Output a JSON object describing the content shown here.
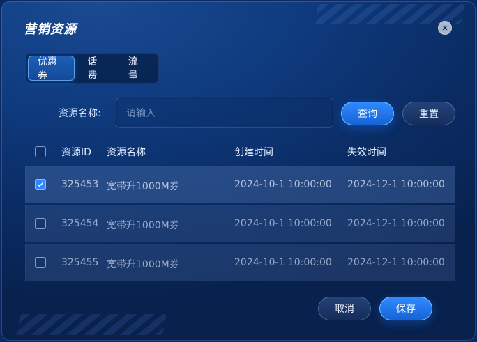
{
  "dialog": {
    "title": "营销资源",
    "close_icon": "close-icon"
  },
  "tabs": [
    {
      "label": "优惠券",
      "active": true
    },
    {
      "label": "话费",
      "active": false
    },
    {
      "label": "流量",
      "active": false
    }
  ],
  "filter": {
    "label": "资源名称:",
    "placeholder": "请输入",
    "query_label": "查询",
    "reset_label": "重置"
  },
  "table": {
    "headers": {
      "resource_id": "资源ID",
      "resource_name": "资源名称",
      "created_time": "创建时间",
      "expire_time": "失效时间"
    },
    "rows": [
      {
        "selected": true,
        "id": "325453",
        "name": "宽带升1000M券",
        "created": "2024-10-1 10:00:00",
        "expire": "2024-12-1 10:00:00"
      },
      {
        "selected": false,
        "id": "325454",
        "name": "宽带升1000M券",
        "created": "2024-10-1 10:00:00",
        "expire": "2024-12-1 10:00:00"
      },
      {
        "selected": false,
        "id": "325455",
        "name": "宽带升1000M券",
        "created": "2024-10-1 10:00:00",
        "expire": "2024-12-1 10:00:00"
      }
    ]
  },
  "footer": {
    "cancel_label": "取消",
    "save_label": "保存"
  },
  "colors": {
    "primary": "#2f86ff",
    "background": "#0b2a63"
  }
}
